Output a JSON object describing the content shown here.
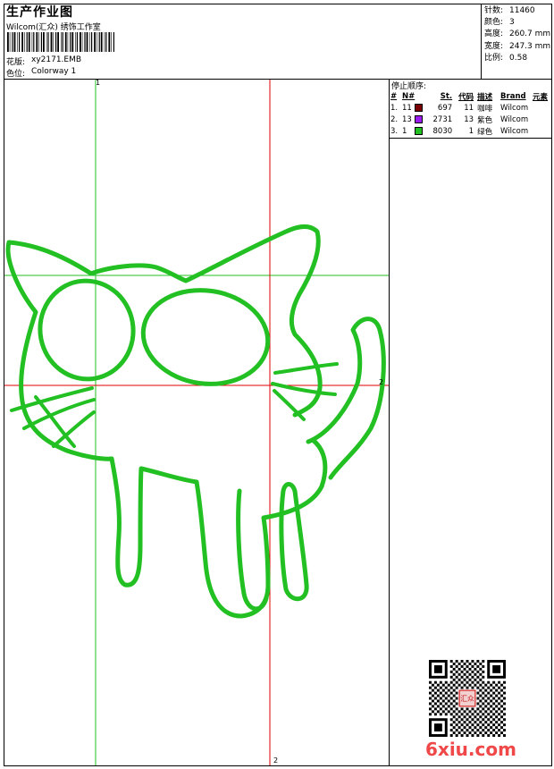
{
  "header": {
    "title": "生产作业图",
    "company": "Wilcom(汇众) 绣饰工作室",
    "design_label": "花版:",
    "design_value": "xy2171.EMB",
    "colorway_label": "色位:",
    "colorway_value": "Colorway 1"
  },
  "stats": [
    {
      "label": "针数:",
      "value": "11460"
    },
    {
      "label": "颜色:",
      "value": "3"
    },
    {
      "label": "高度:",
      "value": "260.7 mm"
    },
    {
      "label": "宽度:",
      "value": "247.3 mm"
    },
    {
      "label": "比例:",
      "value": "0.58"
    }
  ],
  "stop_sequence": {
    "title": "停止顺序:",
    "headers": [
      "#",
      "N#",
      "St.",
      "代码",
      "描述",
      "Brand",
      "元素"
    ],
    "rows": [
      {
        "num": "1.",
        "n": "11",
        "color": "#7a0000",
        "st": "697",
        "code": "11",
        "desc": "咖啡",
        "brand": "Wilcom"
      },
      {
        "num": "2.",
        "n": "13",
        "color": "#9b1cf0",
        "st": "2731",
        "code": "13",
        "desc": "紫色",
        "brand": "Wilcom"
      },
      {
        "num": "3.",
        "n": "1",
        "color": "#22c022",
        "st": "8030",
        "code": "1",
        "desc": "绿色",
        "brand": "Wilcom"
      }
    ]
  },
  "markers": {
    "top": "1",
    "right": "2",
    "bottom": "2"
  },
  "logo": "6xiu.com",
  "stamp": "汇众"
}
